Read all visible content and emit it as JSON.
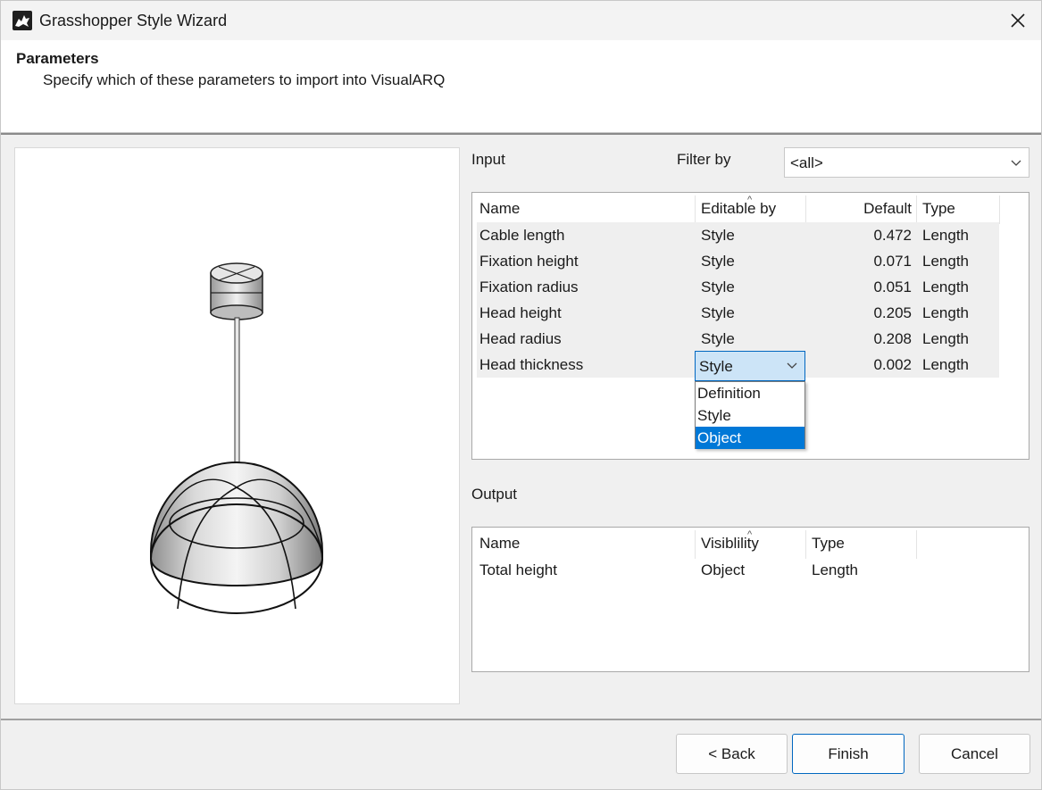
{
  "window": {
    "title": "Grasshopper Style Wizard"
  },
  "header": {
    "title": "Parameters",
    "subtitle": "Specify which of these parameters to import into VisualARQ"
  },
  "input": {
    "label": "Input",
    "filter_label": "Filter by",
    "filter_value": "<all>",
    "columns": [
      "Name",
      "Editable by",
      "Default",
      "Type"
    ],
    "rows": [
      {
        "name": "Cable length",
        "editable_by": "Style",
        "default": "0.472",
        "type": "Length"
      },
      {
        "name": "Fixation height",
        "editable_by": "Style",
        "default": "0.071",
        "type": "Length"
      },
      {
        "name": "Fixation radius",
        "editable_by": "Style",
        "default": "0.051",
        "type": "Length"
      },
      {
        "name": "Head height",
        "editable_by": "Style",
        "default": "0.205",
        "type": "Length"
      },
      {
        "name": "Head radius",
        "editable_by": "Style",
        "default": "0.208",
        "type": "Length"
      },
      {
        "name": "Head thickness",
        "editable_by": "Style",
        "default": "0.002",
        "type": "Length"
      }
    ],
    "dropdown": {
      "current": "Style",
      "options": [
        "Definition",
        "Style",
        "Object"
      ],
      "highlighted": "Object"
    }
  },
  "output": {
    "label": "Output",
    "columns": [
      "Name",
      "Visiblility",
      "Type"
    ],
    "rows": [
      {
        "name": "Total height",
        "visibility": "Object",
        "type": "Length"
      }
    ]
  },
  "buttons": {
    "back": "< Back",
    "finish": "Finish",
    "cancel": "Cancel"
  },
  "icons": {
    "app": "rhino-icon",
    "close": "close-icon",
    "chevron": "chevron-down-icon"
  },
  "colors": {
    "accent": "#0078d7",
    "selection_bg": "#cce4f7"
  }
}
